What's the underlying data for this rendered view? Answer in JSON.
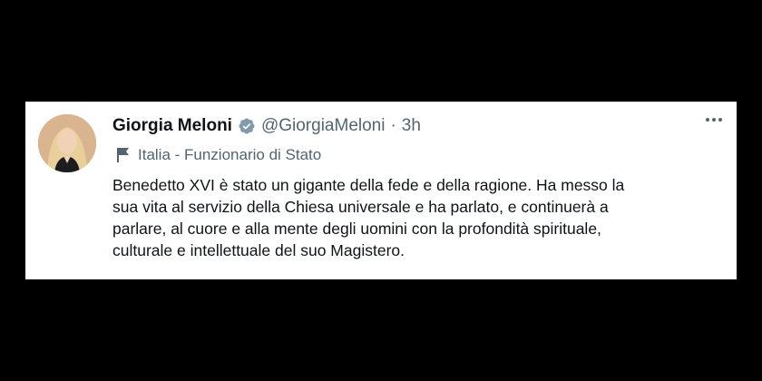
{
  "tweet": {
    "author_name": "Giorgia Meloni",
    "handle": "@GiorgiaMeloni",
    "separator": "·",
    "time": "3h",
    "label": "Italia - Funzionario di Stato",
    "text_lines": [
      "Benedetto XVI è stato un gigante della fede e della ragione. Ha messo la",
      "sua vita al servizio della Chiesa universale e ha parlato, e continuerà a",
      "parlare, al cuore e alla mente degli uomini con la profondità spirituale,",
      "culturale e intellettuale del suo Magistero."
    ]
  },
  "colors": {
    "background": "#000000",
    "card": "#ffffff",
    "text_primary": "#0f1419",
    "text_secondary": "#536471",
    "verified_badge": "#829aab"
  },
  "icons": {
    "verified": "verified-badge-icon",
    "label": "flag-icon",
    "more": "more-options-icon"
  }
}
